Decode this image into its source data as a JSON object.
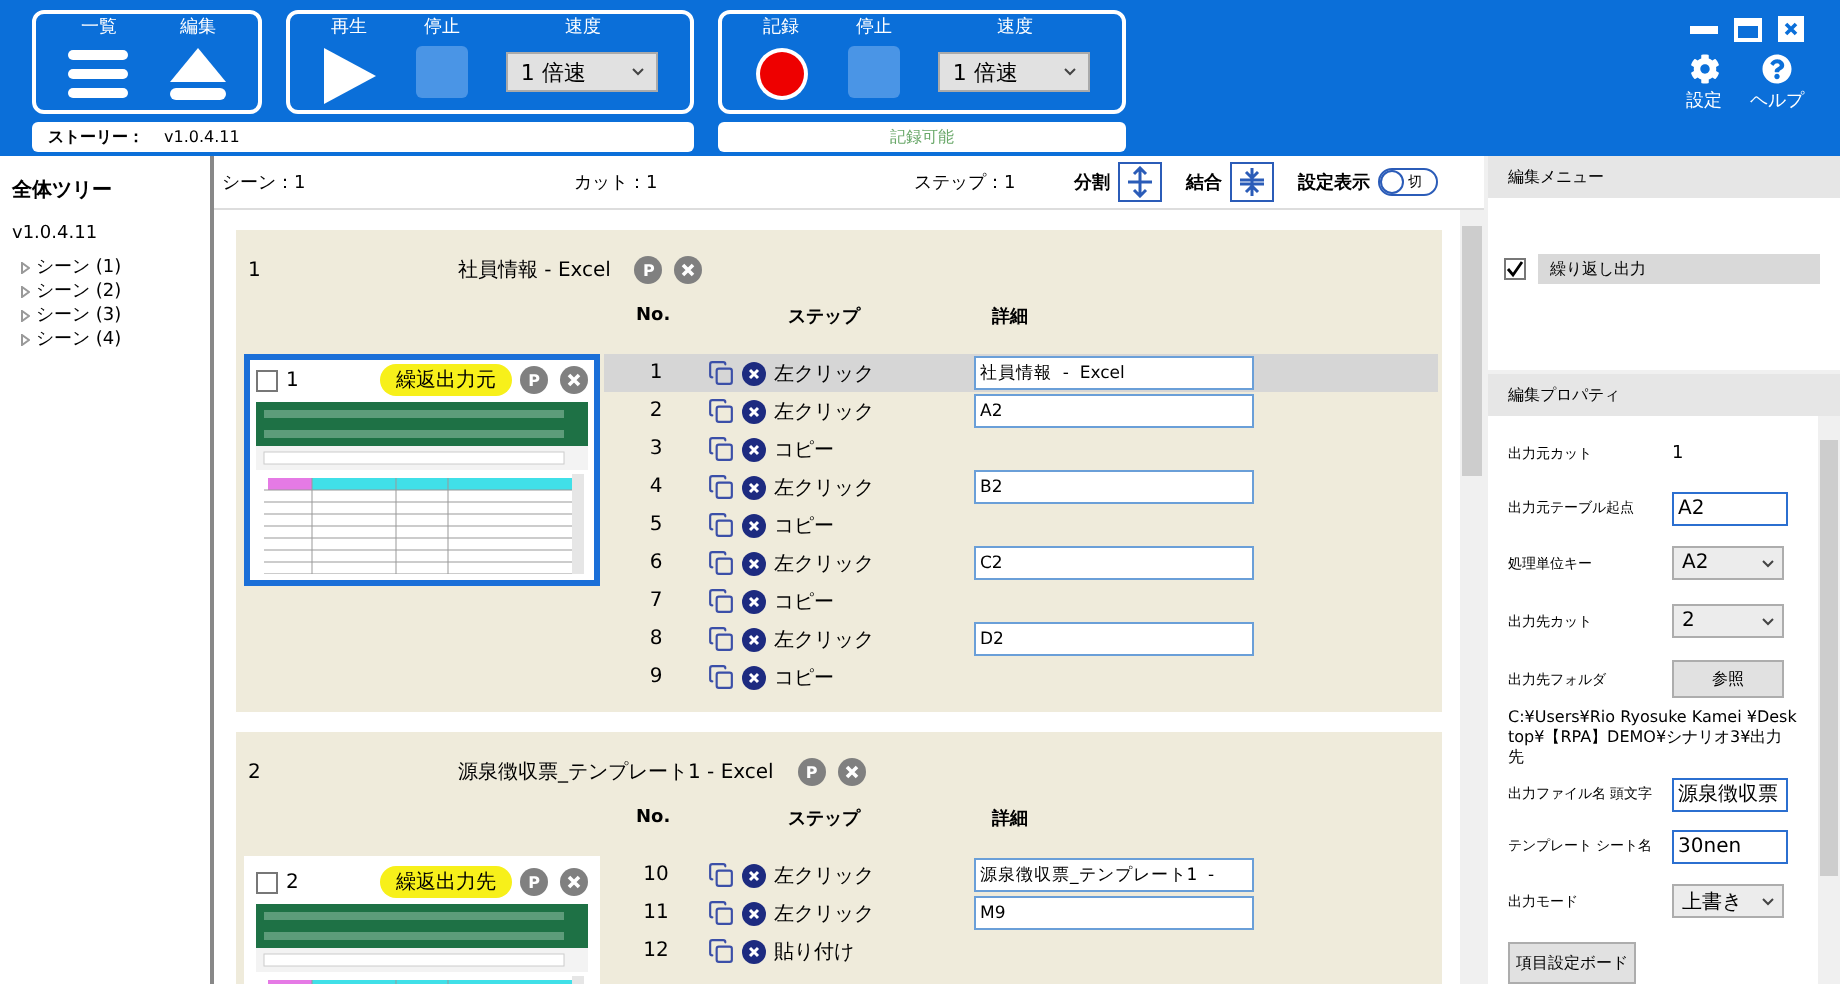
{
  "header": {
    "list_button": "一覧",
    "edit_button": "編集",
    "playback": {
      "play": "再生",
      "stop": {
        "label": "停止",
        "disabled": true
      },
      "speed_label": "速度",
      "speed": "1 倍速"
    },
    "record": {
      "record": "記録",
      "stop": {
        "label": "停止",
        "disabled": true
      },
      "speed_label": "速度",
      "speed": "1 倍速"
    },
    "story": {
      "label": "ストーリー：",
      "value": "v1.0.4.11"
    },
    "record_status": "記録可能",
    "settings": "設定",
    "help": "ヘルプ"
  },
  "tree": {
    "title": "全体ツリー",
    "root": "v1.0.4.11",
    "children": [
      {
        "label": "シーン (1)",
        "expanded": false
      },
      {
        "label": "シーン (2)",
        "expanded": false
      },
      {
        "label": "シーン (3)",
        "expanded": false
      },
      {
        "label": "シーン (4)",
        "expanded": false
      }
    ]
  },
  "info": {
    "scene": "シーン：1",
    "cut": "カット：1",
    "step": "ステップ：1",
    "split": "分割",
    "merge": "結合",
    "settings_display": {
      "label": "設定表示",
      "on": false,
      "state_text": "切"
    }
  },
  "scenes": [
    {
      "number": "1",
      "title": "社員情報 - Excel",
      "p_button": "P",
      "columns": [
        "No.",
        "ステップ",
        "詳細"
      ],
      "cut": {
        "number": "1",
        "checked": false,
        "selected": true,
        "badge": "繰返出力元",
        "p_button": "P"
      },
      "steps": [
        {
          "no": "1",
          "action": "左クリック",
          "detail": "社員情報  -  Excel",
          "selected": true
        },
        {
          "no": "2",
          "action": "左クリック",
          "detail": "A2",
          "selected": false
        },
        {
          "no": "3",
          "action": "コピー",
          "selected": false
        },
        {
          "no": "4",
          "action": "左クリック",
          "detail": "B2",
          "selected": false
        },
        {
          "no": "5",
          "action": "コピー",
          "selected": false
        },
        {
          "no": "6",
          "action": "左クリック",
          "detail": "C2",
          "selected": false
        },
        {
          "no": "7",
          "action": "コピー",
          "selected": false
        },
        {
          "no": "8",
          "action": "左クリック",
          "detail": "D2",
          "selected": false
        },
        {
          "no": "9",
          "action": "コピー",
          "selected": false
        }
      ]
    },
    {
      "number": "2",
      "title": "源泉徴収票_テンプレート1 - Excel",
      "p_button": "P",
      "columns": [
        "No.",
        "ステップ",
        "詳細"
      ],
      "cut": {
        "number": "2",
        "checked": false,
        "selected": false,
        "badge": "繰返出力先",
        "p_button": "P"
      },
      "steps": [
        {
          "no": "10",
          "action": "左クリック",
          "detail": "源泉徴収票_テンプレート1  -",
          "selected": false
        },
        {
          "no": "11",
          "action": "左クリック",
          "detail": "M9",
          "selected": false
        },
        {
          "no": "12",
          "action": "貼り付け",
          "selected": false
        }
      ]
    }
  ],
  "edit_menu": {
    "title": "編集メニュー",
    "items": [
      {
        "label": "繰り返し出力",
        "checked": true
      }
    ]
  },
  "properties": {
    "title": "編集プロパティ",
    "rows": [
      {
        "kind": "text",
        "label": "出力元カット",
        "value": "1"
      },
      {
        "kind": "input",
        "label": "出力元テーブル起点",
        "value": "A2"
      },
      {
        "kind": "select",
        "label": "処理単位キー",
        "value": "A2"
      },
      {
        "kind": "select",
        "label": "出力先カット",
        "value": "2"
      },
      {
        "kind": "button",
        "label": "出力先フォルダ",
        "value": "参照"
      },
      {
        "kind": "note",
        "value": "C:¥Users¥Rio Ryosuke Kamei ¥Desktop¥【RPA】DEMO¥シナリオ3¥出力先"
      },
      {
        "kind": "input",
        "label": "出力ファイル名 頭文字",
        "value": "源泉徴収票"
      },
      {
        "kind": "input",
        "label": "テンプレート シート名",
        "value": "30nen"
      },
      {
        "kind": "select",
        "label": "出力モード",
        "value": "上書き"
      }
    ],
    "board_button": "項目設定ボード"
  }
}
